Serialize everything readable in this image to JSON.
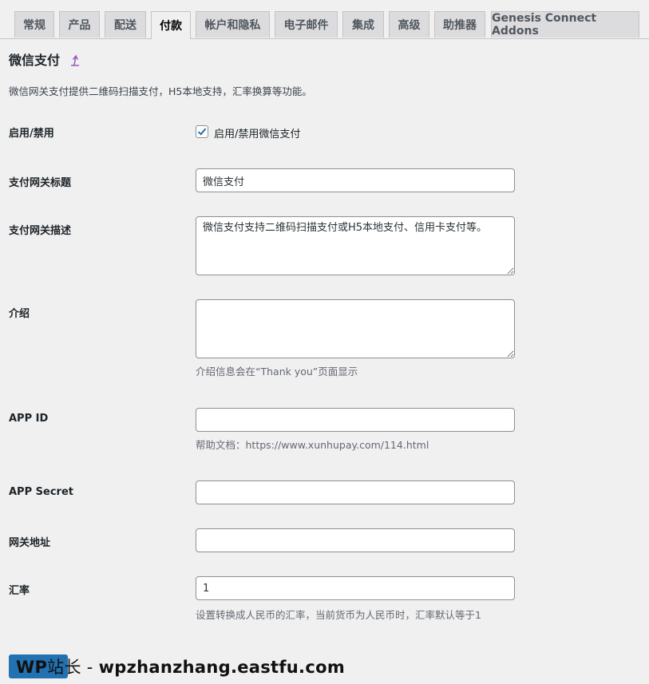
{
  "tabs": [
    {
      "label": "常规"
    },
    {
      "label": "产品"
    },
    {
      "label": "配送"
    },
    {
      "label": "付款"
    },
    {
      "label": "帐户和隐私"
    },
    {
      "label": "电子邮件"
    },
    {
      "label": "集成"
    },
    {
      "label": "高级"
    },
    {
      "label": "助推器"
    },
    {
      "label": "Genesis Connect Addons"
    }
  ],
  "active_tab": "付款",
  "section": {
    "title": "微信支付",
    "description": "微信网关支付提供二维码扫描支付，H5本地支持，汇率换算等功能。",
    "link_icon": "upload-arrow-icon"
  },
  "fields": {
    "enabled": {
      "label": "启用/禁用",
      "checkbox_label": "启用/禁用微信支付",
      "checked": true
    },
    "title": {
      "label": "支付网关标题",
      "value": "微信支付"
    },
    "description": {
      "label": "支付网关描述",
      "value": "微信支付支持二维码扫描支付或H5本地支付、信用卡支付等。"
    },
    "intro": {
      "label": "介绍",
      "value": "",
      "help": "介绍信息会在“Thank you”页面显示"
    },
    "app_id": {
      "label": "APP ID",
      "value": "",
      "help": "帮助文档：https://www.xunhupay.com/114.html"
    },
    "app_secret": {
      "label": "APP Secret",
      "value": ""
    },
    "gateway": {
      "label": "网关地址",
      "value": ""
    },
    "rate": {
      "label": "汇率",
      "value": "1",
      "help": "设置转换成人民币的汇率，当前货币为人民币时，汇率默认等于1"
    }
  },
  "watermark": {
    "brand": "WP",
    "mid": "站长 - ",
    "domain": "wpzhanzhang.eastfu.com"
  },
  "colors": {
    "accent": "#2271b1",
    "link_icon": "#9b59b6"
  }
}
